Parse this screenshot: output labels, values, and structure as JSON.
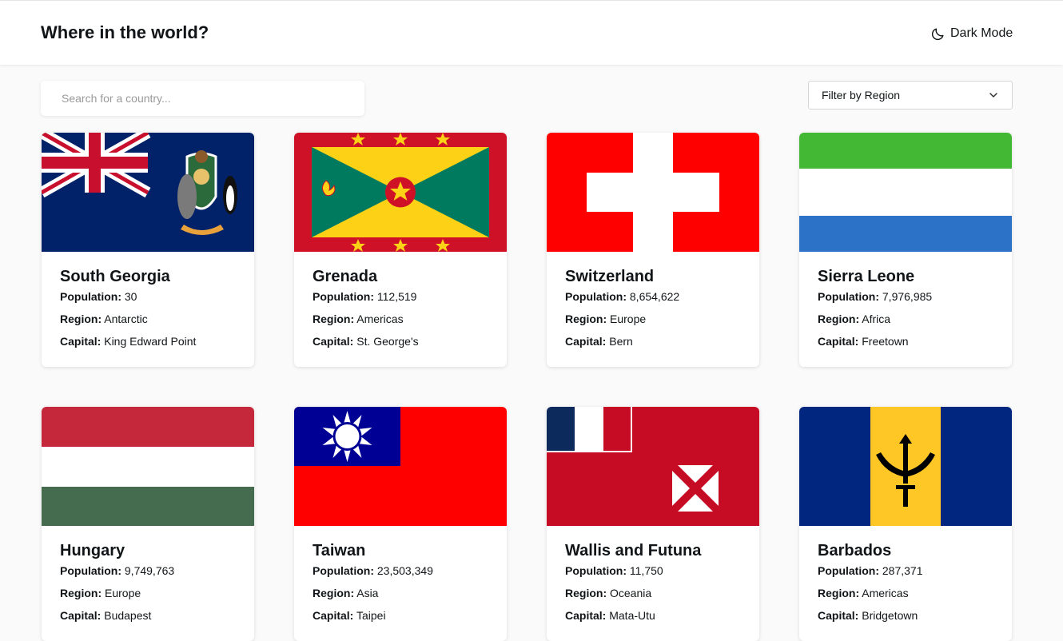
{
  "header": {
    "title": "Where in the world?",
    "dark_mode_label": "Dark Mode"
  },
  "search": {
    "placeholder": "Search for a country..."
  },
  "filter": {
    "label": "Filter by Region"
  },
  "labels": {
    "population": "Population:",
    "region": "Region:",
    "capital": "Capital:"
  },
  "countries": [
    {
      "name": "South Georgia",
      "population": "30",
      "region": "Antarctic",
      "capital": "King Edward Point"
    },
    {
      "name": "Grenada",
      "population": "112,519",
      "region": "Americas",
      "capital": "St. George's"
    },
    {
      "name": "Switzerland",
      "population": "8,654,622",
      "region": "Europe",
      "capital": "Bern"
    },
    {
      "name": "Sierra Leone",
      "population": "7,976,985",
      "region": "Africa",
      "capital": "Freetown"
    },
    {
      "name": "Hungary",
      "population": "9,749,763",
      "region": "Europe",
      "capital": "Budapest"
    },
    {
      "name": "Taiwan",
      "population": "23,503,349",
      "region": "Asia",
      "capital": "Taipei"
    },
    {
      "name": "Wallis and Futuna",
      "population": "11,750",
      "region": "Oceania",
      "capital": "Mata-Utu"
    },
    {
      "name": "Barbados",
      "population": "287,371",
      "region": "Americas",
      "capital": "Bridgetown"
    }
  ],
  "icons": {
    "dark_mode": "moon-icon",
    "filter": "chevron-down-icon"
  },
  "colors": {
    "background": "#fafafa",
    "card": "#ffffff",
    "text": "#111517"
  }
}
